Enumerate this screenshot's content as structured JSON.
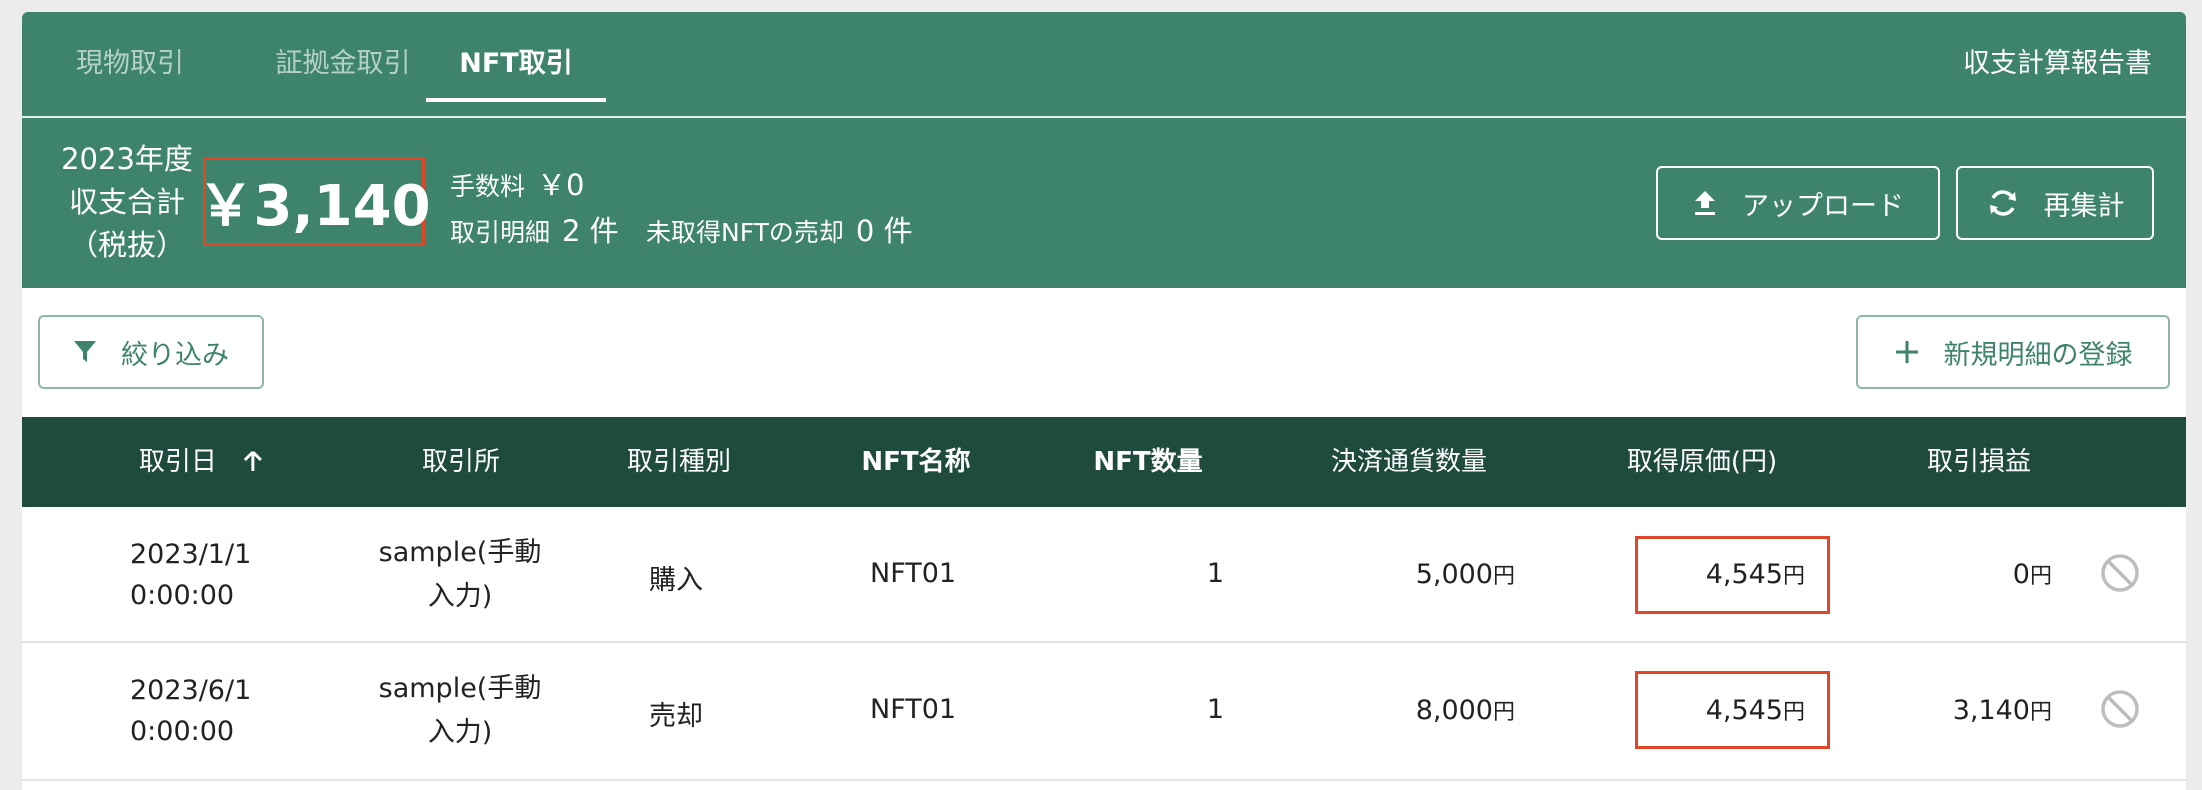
{
  "tabs": [
    {
      "label": "現物取引",
      "active": false
    },
    {
      "label": "証拠金取引",
      "active": false
    },
    {
      "label": "NFT取引",
      "active": true
    }
  ],
  "report_link": "収支計算報告書",
  "summary": {
    "fiscal_year_lines": [
      "2023年度",
      "収支合計",
      "（税抜）"
    ],
    "total": "￥3,140",
    "fee_label": "手数料",
    "fee_value": "￥0",
    "details_label": "取引明細",
    "details_value": "2 件",
    "unacquired_label": "未取得NFTの売却",
    "unacquired_value": "0 件"
  },
  "buttons": {
    "upload": "アップロード",
    "recalc": "再集計",
    "filter": "絞り込み",
    "new_entry": "新規明細の登録"
  },
  "table": {
    "columns": [
      "取引日",
      "取引所",
      "取引種別",
      "NFT名称",
      "NFT数量",
      "決済通貨数量",
      "取得原価(円)",
      "取引損益"
    ],
    "yen_unit": "円",
    "rows": [
      {
        "date_line1": "2023/1/1",
        "date_line2": "0:00:00",
        "exchange_line1": "sample(手動",
        "exchange_line2": "入力)",
        "type": "購入",
        "nft_name": "NFT01",
        "nft_qty": "1",
        "settlement": "5,000",
        "cost": "4,545",
        "pnl": "0"
      },
      {
        "date_line1": "2023/6/1",
        "date_line2": "0:00:00",
        "exchange_line1": "sample(手動",
        "exchange_line2": "入力)",
        "type": "売却",
        "nft_name": "NFT01",
        "nft_qty": "1",
        "settlement": "8,000",
        "cost": "4,545",
        "pnl": "3,140"
      }
    ]
  },
  "colors": {
    "header_green": "#3e846d",
    "table_header": "#1e4b3e",
    "highlight_red": "#e0472a"
  }
}
